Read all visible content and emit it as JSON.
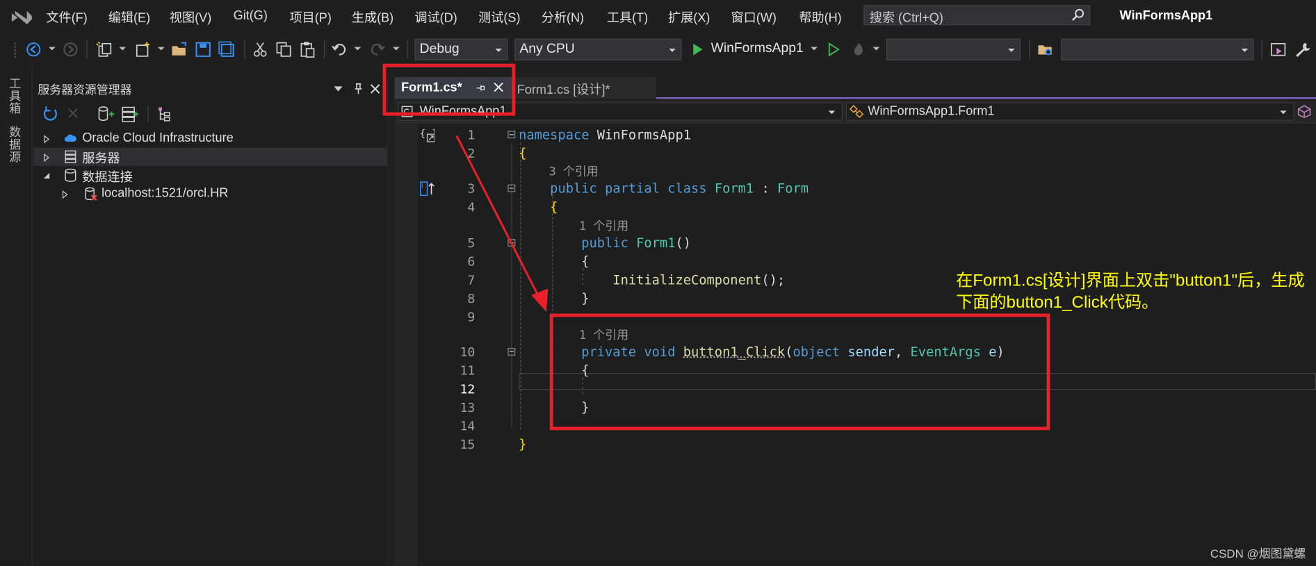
{
  "menu": {
    "items": [
      "文件(F)",
      "编辑(E)",
      "视图(V)",
      "Git(G)",
      "项目(P)",
      "生成(B)",
      "调试(D)",
      "测试(S)",
      "分析(N)",
      "工具(T)",
      "扩展(X)",
      "窗口(W)",
      "帮助(H)"
    ],
    "search_placeholder": "搜索 (Ctrl+Q)",
    "app_title": "WinFormsApp1"
  },
  "toolbar": {
    "configuration": "Debug",
    "platform": "Any CPU",
    "run_target": "WinFormsApp1",
    "icons": [
      "navigate-back-icon",
      "navigate-forward-icon",
      "new-project-icon",
      "add-item-icon",
      "open-file-icon",
      "save-icon",
      "save-all-icon",
      "cut-icon",
      "copy-icon",
      "paste-icon",
      "undo-icon",
      "redo-icon",
      "start-debug-icon",
      "start-without-debug-icon",
      "hot-reload-icon",
      "browse-folder-icon",
      "designer-icon",
      "wrench-icon"
    ]
  },
  "side_tabs": [
    "工具箱",
    "数据源"
  ],
  "server_explorer": {
    "title": "服务器资源管理器",
    "tree": [
      {
        "label": "Oracle Cloud Infrastructure",
        "icon": "cloud-icon",
        "expanded": false,
        "level": 0
      },
      {
        "label": "服务器",
        "icon": "server-icon",
        "expanded": false,
        "level": 0,
        "selected": true
      },
      {
        "label": "数据连接",
        "icon": "database-icon",
        "expanded": true,
        "level": 0
      },
      {
        "label": "localhost:1521/orcl.HR",
        "icon": "database-connection-error-icon",
        "expanded": false,
        "level": 1
      }
    ]
  },
  "editor": {
    "tabs": [
      {
        "label": "Form1.cs*",
        "active": true
      },
      {
        "label": "Form1.cs [设计]*",
        "active": false
      }
    ],
    "nav_left": "WinFormsApp1",
    "nav_right": "WinFormsApp1.Form1",
    "current_line": 12,
    "references_3": "3 个引用",
    "references_1": "1 个引用"
  },
  "colors": {
    "keyword": "#569cd6",
    "type": "#4ec9b0",
    "method": "#dcdcaa",
    "annotation_red": "#e8202a",
    "annotation_text": "#ffff00",
    "tab_accent": "#7b5fc0"
  },
  "annotation": "在Form1.cs[设计]界面上双击\"button1\"后，生成下面的button1_Click代码。",
  "watermark": "CSDN @烟图黛螺"
}
